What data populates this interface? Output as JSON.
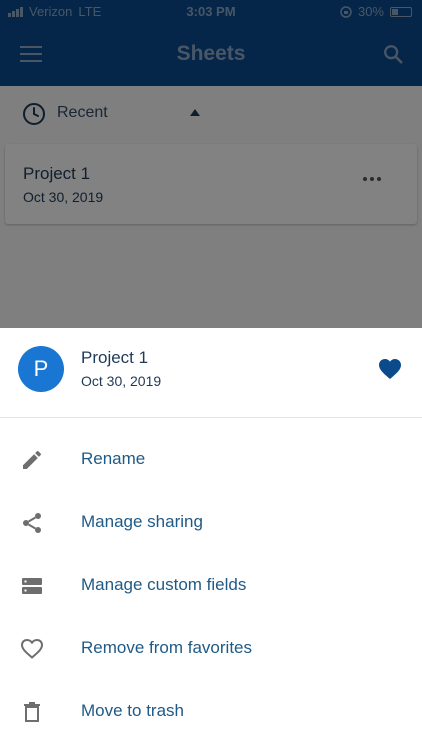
{
  "status_bar": {
    "carrier": "Verizon",
    "network": "LTE",
    "time": "3:03 PM",
    "battery": "30%"
  },
  "app_bar": {
    "title": "Sheets",
    "menu_icon": "hamburger-menu-icon",
    "search_icon": "search-icon"
  },
  "filter": {
    "label": "Recent",
    "icon": "clock-icon",
    "sort_icon": "sort-up-arrow-icon"
  },
  "sheets": [
    {
      "title": "Project 1",
      "date": "Oct 30, 2019"
    }
  ],
  "bottom_sheet": {
    "avatar_letter": "P",
    "title": "Project 1",
    "date": "Oct 30, 2019",
    "favorite_icon": "heart-filled-icon",
    "actions": [
      {
        "label": "Rename",
        "icon": "pencil-icon"
      },
      {
        "label": "Manage sharing",
        "icon": "share-icon"
      },
      {
        "label": "Manage custom fields",
        "icon": "custom-fields-icon"
      },
      {
        "label": "Remove from favorites",
        "icon": "heart-outline-icon"
      },
      {
        "label": "Move to trash",
        "icon": "trash-icon"
      }
    ]
  },
  "colors": {
    "brand": "#0b4a8b",
    "accent": "#1976d2",
    "action_text": "#1f5a86"
  }
}
